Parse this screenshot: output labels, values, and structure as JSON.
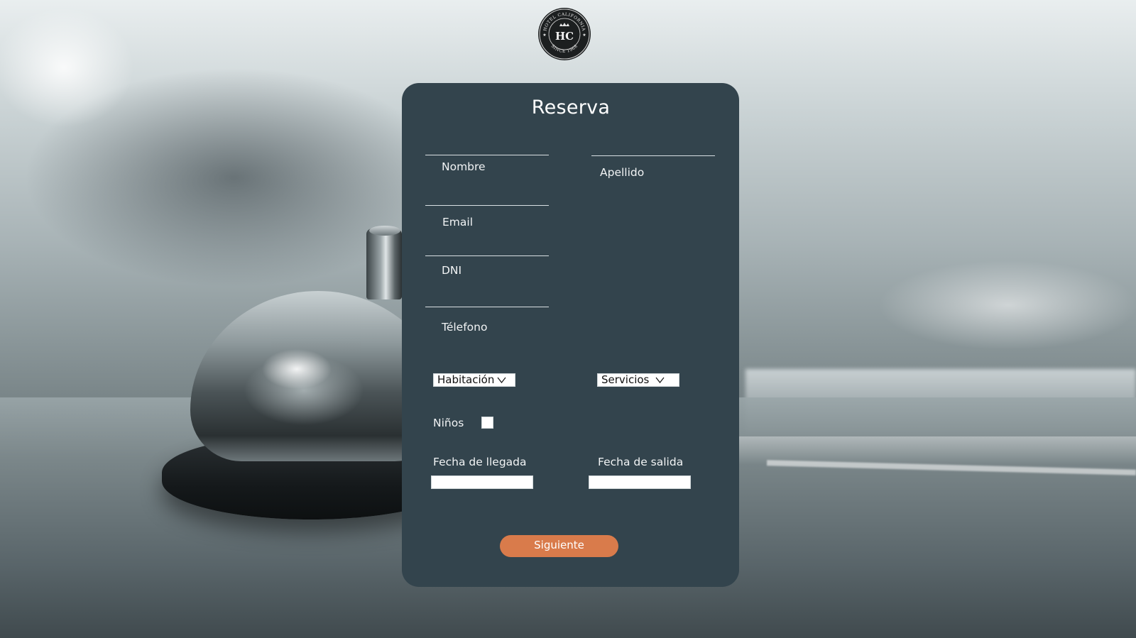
{
  "logo": {
    "initials": "HC",
    "ring_text_top": "HOTEL CALIFORNIA",
    "ring_text_bottom": "SINCE 1968"
  },
  "form": {
    "title": "Reserva",
    "fields": {
      "nombre": "Nombre",
      "apellido": "Apellido",
      "email": "Email",
      "dni": "DNI",
      "telefono": "Télefono"
    },
    "habitacion_select": "Habitación",
    "servicios_select": "Servicios",
    "ninos_label": "Niños",
    "fecha_llegada_label": "Fecha de llegada",
    "fecha_salida_label": "Fecha de salida",
    "next_button": "Siguiente"
  },
  "colors": {
    "card_background": "#33444d",
    "button_accent": "#d97b4b",
    "text": "#ffffff"
  },
  "icons": {
    "select_arrow": "chevron-down-icon"
  }
}
